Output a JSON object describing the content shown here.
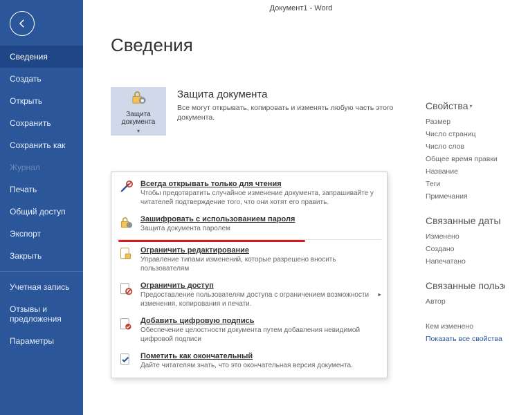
{
  "titlebar": "Документ1  -  Word",
  "page_title": "Сведения",
  "nav": {
    "items": [
      {
        "label": "Сведения",
        "active": true
      },
      {
        "label": "Создать"
      },
      {
        "label": "Открыть"
      },
      {
        "label": "Сохранить"
      },
      {
        "label": "Сохранить как"
      },
      {
        "label": "Журнал",
        "disabled": true
      },
      {
        "label": "Печать"
      },
      {
        "label": "Общий доступ"
      },
      {
        "label": "Экспорт"
      },
      {
        "label": "Закрыть"
      }
    ],
    "footer": [
      {
        "label": "Учетная запись"
      },
      {
        "label": "Отзывы и предложения"
      },
      {
        "label": "Параметры"
      }
    ]
  },
  "protect": {
    "button_label": "Защита документа",
    "title": "Защита документа",
    "desc": "Все могут открывать, копировать и изменять любую часть этого документа."
  },
  "dropdown": [
    {
      "icon": "readonly",
      "title": "Всегда открывать только для чтения",
      "desc": "Чтобы предотвратить случайное изменение документа, запрашивайте у читателей подтверждение того, что они хотят его править."
    },
    {
      "icon": "encrypt",
      "title": "Зашифровать с использованием пароля",
      "desc": "Защита документа паролем"
    },
    {
      "icon": "restrict-edit",
      "title": "Ограничить редактирование",
      "desc": "Управление типами изменений, которые разрешено вносить пользователям"
    },
    {
      "icon": "restrict-access",
      "title": "Ограничить доступ",
      "desc": "Предоставление пользователям доступа с ограничением возможности изменения, копирования и печати.",
      "submenu": true
    },
    {
      "icon": "signature",
      "title": "Добавить цифровую подпись",
      "desc": "Обеспечение целостности документа путем добавления невидимой цифровой подписи"
    },
    {
      "icon": "final",
      "title": "Пометить как окончательный",
      "desc": "Дайте читателям знать, что это окончательная версия документа."
    }
  ],
  "props": {
    "heading": "Свойства",
    "items": [
      "Размер",
      "Число страниц",
      "Число слов",
      "Общее время правки",
      "Название",
      "Теги",
      "Примечания"
    ]
  },
  "dates": {
    "heading": "Связанные даты",
    "items": [
      "Изменено",
      "Создано",
      "Напечатано"
    ]
  },
  "people": {
    "heading": "Связанные пользователи",
    "items": [
      "Автор"
    ]
  },
  "footer_info": {
    "changed_by": "Кем изменено",
    "show_all": "Показать все свойства"
  }
}
